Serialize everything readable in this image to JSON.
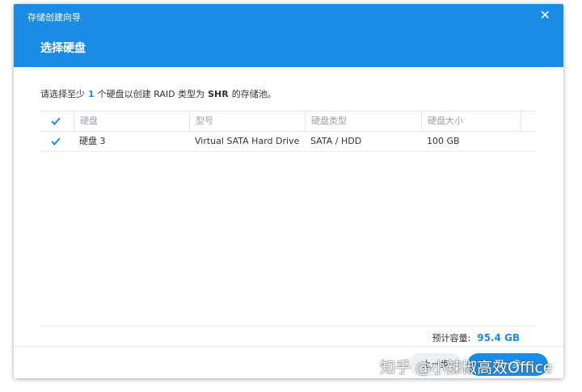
{
  "dialog": {
    "wizard_title": "存储创建向导",
    "step_title": "选择硬盘"
  },
  "instruction": {
    "prefix": "请选择至少",
    "count": "1",
    "middle": "个硬盘以创建 RAID 类型为",
    "raid": "SHR",
    "suffix": "的存储池。"
  },
  "table": {
    "columns": [
      "硬盘",
      "型号",
      "硬盘类型",
      "硬盘大小"
    ],
    "rows": [
      {
        "checked": true,
        "disk": "硬盘 3",
        "model": "Virtual SATA Hard Drive",
        "type": "SATA / HDD",
        "size": "100 GB"
      }
    ]
  },
  "capacity": {
    "label": "预计容量:",
    "value": "95.4 GB"
  },
  "buttons": {
    "prev": "上一步",
    "next": "下一步"
  },
  "watermark": "知乎 @小辣椒高效Office",
  "colors": {
    "accent": "#1a8ce5"
  }
}
